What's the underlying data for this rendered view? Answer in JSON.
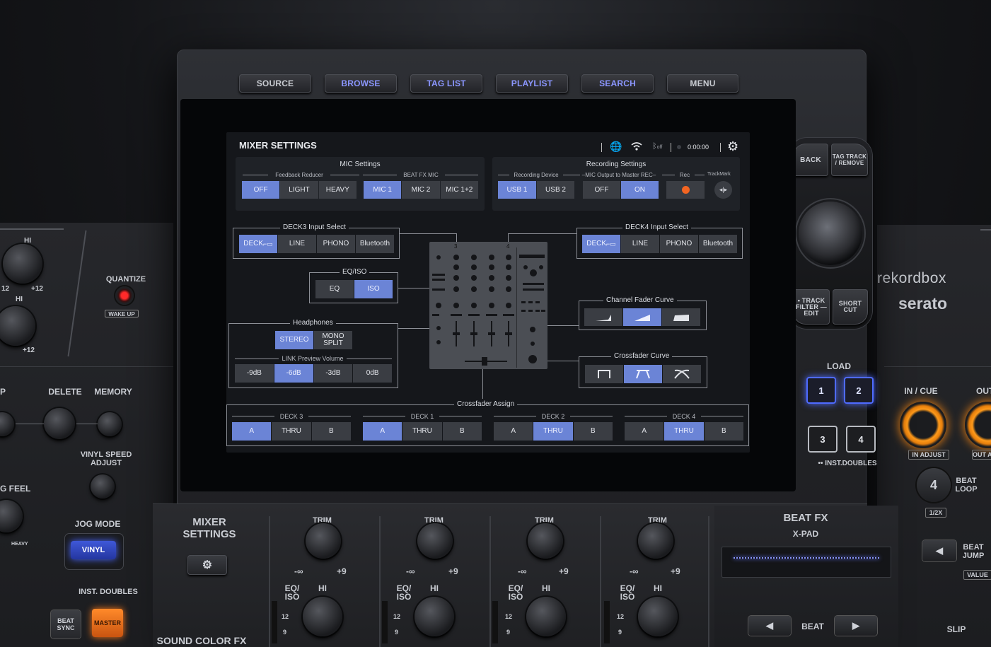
{
  "hardware": {
    "top_buttons": [
      {
        "label": "SOURCE",
        "active": false
      },
      {
        "label": "BROWSE",
        "active": true
      },
      {
        "label": "TAG LIST",
        "active": true
      },
      {
        "label": "PLAYLIST",
        "active": true
      },
      {
        "label": "SEARCH",
        "active": true
      },
      {
        "label": "MENU",
        "active": false
      }
    ],
    "right": {
      "back": "BACK",
      "tag_track": "TAG TRACK / REMOVE",
      "track_filter": "• TRACK FILTER — EDIT",
      "short_cut": "SHORT CUT",
      "rekordbox": "rekordbox",
      "serato": "serato",
      "load": "LOAD",
      "load_buttons": [
        "1",
        "2",
        "3",
        "4"
      ],
      "inst_doubles": "•• INST.DOUBLES",
      "in_cue": "IN / CUE",
      "out": "OUT",
      "in_adjust": "IN ADJUST",
      "out_adjust": "OUT A",
      "beat_loop_num": "4",
      "beat_loop": "BEAT LOOP",
      "half": "1/2X",
      "beat_jump": "BEAT JUMP",
      "value": "VALUE",
      "slip": "SLIP"
    },
    "left": {
      "hi_top": "HI",
      "hi_mid": "HI",
      "knob_range": "+12",
      "knob_low": "12",
      "quantize": "QUANTIZE",
      "wake_up": "WAKE UP",
      "delete": "DELETE",
      "memory": "MEMORY",
      "p": "P",
      "vinyl_speed": "VINYL SPEED ADJUST",
      "g_feel": "G FEEL",
      "heavy": "HEAVY",
      "jog_mode": "JOG MODE",
      "vinyl": "VINYL",
      "inst_doubles": "INST. DOUBLES",
      "beat_sync": "BEAT SYNC",
      "master": "MASTER"
    },
    "bottom": {
      "mixer_settings": "MIXER SETTINGS",
      "sound_color_fx": "SOUND COLOR FX",
      "trim": "TRIM",
      "minus_inf": "-∞",
      "plus9": "+9",
      "eq_iso": "EQ/ ISO",
      "hi": "HI",
      "n12": "12",
      "n9": "9",
      "beat_fx": "BEAT FX",
      "x_pad": "X-PAD",
      "beat": "BEAT"
    }
  },
  "screen": {
    "title": "MIXER SETTINGS",
    "timer": "0:00:00",
    "bt_off": "off",
    "mic": {
      "title": "MIC Settings",
      "feedback_label": "Feedback Reducer",
      "feedback": [
        {
          "label": "OFF",
          "on": true
        },
        {
          "label": "LIGHT",
          "on": false
        },
        {
          "label": "HEAVY",
          "on": false
        }
      ],
      "beatfx_label": "BEAT FX MIC",
      "beatfx": [
        {
          "label": "MIC 1",
          "on": true
        },
        {
          "label": "MIC 2",
          "on": false
        },
        {
          "label": "MIC 1+2",
          "on": false
        }
      ]
    },
    "rec": {
      "title": "Recording Settings",
      "device_label": "Recording Device",
      "device": [
        {
          "label": "USB 1",
          "on": true
        },
        {
          "label": "USB 2",
          "on": false
        }
      ],
      "mic_out_label": "–MIC Output to Master REC–",
      "mic_out": [
        {
          "label": "OFF",
          "on": false
        },
        {
          "label": "ON",
          "on": true
        }
      ],
      "rec_label": "Rec",
      "trackmark_label": "TrackMark"
    },
    "deck3": {
      "title": "DECK3 Input Select",
      "options": [
        {
          "label": "DECK",
          "on": true
        },
        {
          "label": "LINE",
          "on": false
        },
        {
          "label": "PHONO",
          "on": false
        },
        {
          "label": "Bluetooth",
          "on": false
        }
      ]
    },
    "deck4": {
      "title": "DECK4 Input Select",
      "options": [
        {
          "label": "DECK",
          "on": true
        },
        {
          "label": "LINE",
          "on": false
        },
        {
          "label": "PHONO",
          "on": false
        },
        {
          "label": "Bluetooth",
          "on": false
        }
      ]
    },
    "eqiso": {
      "title": "EQ/ISO",
      "options": [
        {
          "label": "EQ",
          "on": false
        },
        {
          "label": "ISO",
          "on": true
        }
      ]
    },
    "headphones": {
      "title": "Headphones",
      "options": [
        {
          "label": "STEREO",
          "on": true
        },
        {
          "label": "MONO SPLIT",
          "on": false
        }
      ],
      "link_label": "LINK Preview Volume",
      "link": [
        {
          "label": "-9dB",
          "on": false
        },
        {
          "label": "-6dB",
          "on": true
        },
        {
          "label": "-3dB",
          "on": false
        },
        {
          "label": "0dB",
          "on": false
        }
      ]
    },
    "channel_curve": {
      "title": "Channel Fader Curve",
      "selected": 1
    },
    "cross_curve": {
      "title": "Crossfader Curve",
      "selected": 1
    },
    "mixer_ch": {
      "c3": "3",
      "c4": "4"
    },
    "assign": {
      "title": "Crossfader Assign",
      "decks": [
        {
          "name": "DECK 3",
          "sel": "A"
        },
        {
          "name": "DECK 1",
          "sel": "A"
        },
        {
          "name": "DECK 2",
          "sel": "THRU"
        },
        {
          "name": "DECK 4",
          "sel": "THRU"
        }
      ],
      "options": [
        "A",
        "THRU",
        "B"
      ]
    }
  },
  "colors": {
    "accent": "#6b84d6",
    "hw_blue": "#7a86ff",
    "rec_orange": "#f26522"
  }
}
